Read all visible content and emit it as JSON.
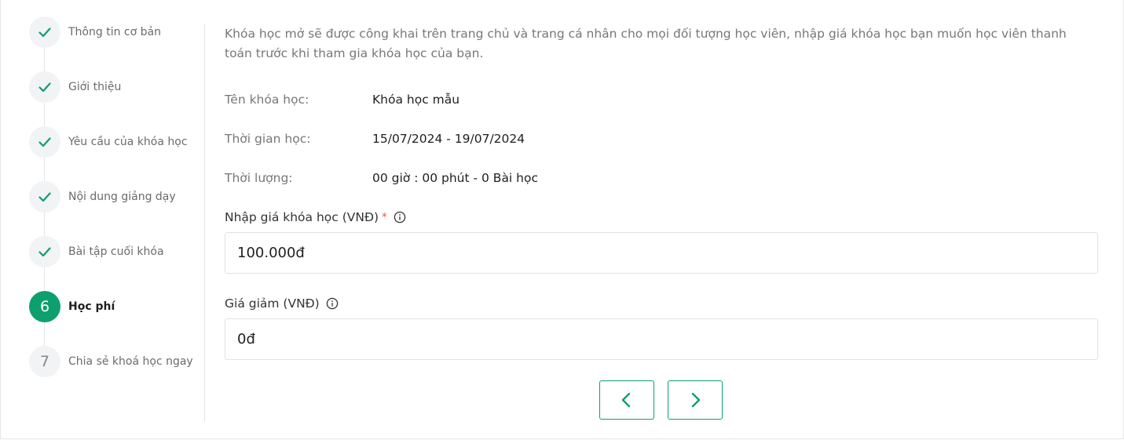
{
  "stepper": {
    "steps": [
      {
        "number": "1",
        "label": "Thông tin cơ bản",
        "state": "done"
      },
      {
        "number": "2",
        "label": "Giới thiệu",
        "state": "done"
      },
      {
        "number": "3",
        "label": "Yêu cầu của khóa học",
        "state": "done"
      },
      {
        "number": "4",
        "label": "Nội dung giảng dạy",
        "state": "done"
      },
      {
        "number": "5",
        "label": "Bài tập cuối khóa",
        "state": "done"
      },
      {
        "number": "6",
        "label": "Học phí",
        "state": "active"
      },
      {
        "number": "7",
        "label": "Chia sẻ khoá học ngay",
        "state": "pending"
      }
    ]
  },
  "main": {
    "description": "Khóa học mở sẽ được công khai trên trang chủ và trang cá nhân cho mọi đối tượng học viên, nhập giá khóa học bạn muốn học viên thanh toán trước khi tham gia khóa học của bạn.",
    "course_name_label": "Tên khóa học:",
    "course_name_value": "Khóa học mẫu",
    "schedule_label": "Thời gian học:",
    "schedule_value": "15/07/2024 - 19/07/2024",
    "duration_label": "Thời lượng:",
    "duration_value": "00 giờ : 00 phút - 0 Bài học",
    "price_label": "Nhập giá khóa học (VNĐ)",
    "price_required_mark": "*",
    "price_value": "100.000đ",
    "discount_label": "Giá giảm (VNĐ)",
    "discount_value": "0đ"
  },
  "colors": {
    "accent": "#0e9f6e",
    "required": "#d9534f"
  },
  "icons": {
    "done": "check-icon",
    "info": "info-circle-icon",
    "prev": "chevron-left-icon",
    "next": "chevron-right-icon"
  }
}
